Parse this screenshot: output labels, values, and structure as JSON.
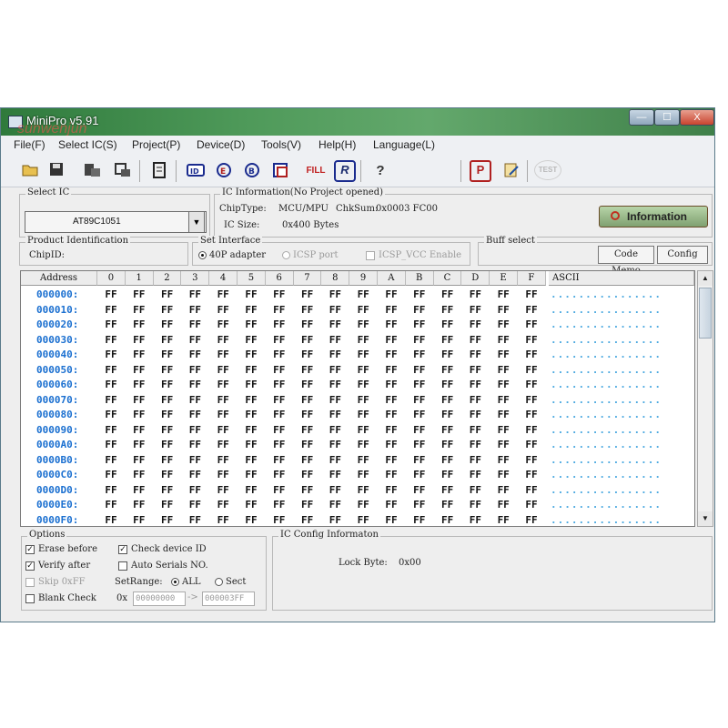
{
  "window": {
    "title": "MiniPro v5.91",
    "watermark": "sunwenjun",
    "controls": {
      "minimize": "—",
      "maximize": "☐",
      "close": "X"
    }
  },
  "menu": [
    "File(F)",
    "Select IC(S)",
    "Project(P)",
    "Device(D)",
    "Tools(V)",
    "Help(H)",
    "Language(L)"
  ],
  "toolbar": {
    "icons": [
      "open-icon",
      "save-icon",
      "load-icon",
      "save-file-icon",
      "chip-icon",
      "read-icon",
      "erase-icon",
      "blank-check-icon",
      "verify-icon",
      "fill-icon",
      "program-icon",
      "help-icon",
      "protect-icon",
      "edit-icon",
      "test-icon"
    ],
    "fill_label": "FILL",
    "r_label": "R",
    "p_label": "P",
    "test_label": "TEST",
    "help_label": "?"
  },
  "select_ic": {
    "label": "Select IC",
    "value": "AT89C1051",
    "arrow": "▼"
  },
  "ic_info": {
    "label": "IC Information(No Project opened)",
    "chip_type_label": "ChipType:",
    "chip_type": "MCU/MPU",
    "checksum_label": "ChkSum:",
    "checksum": "0x0003 FC00",
    "size_label": "IC Size:",
    "size": "0x400 Bytes",
    "info_button": "Information"
  },
  "product_id": {
    "label": "Product Identification",
    "chipid_label": "ChipID:"
  },
  "interface": {
    "label": "Set Interface",
    "option_40p": "40P adapter",
    "option_icsp": "ICSP port",
    "icsp_vcc": "ICSP_VCC Enable"
  },
  "buff_select": {
    "label": "Buff select",
    "code_memo": "Code Memo",
    "config": "Config"
  },
  "hex": {
    "address_header": "Address",
    "columns": [
      "0",
      "1",
      "2",
      "3",
      "4",
      "5",
      "6",
      "7",
      "8",
      "9",
      "A",
      "B",
      "C",
      "D",
      "E",
      "F"
    ],
    "ascii_header": "ASCII",
    "addresses": [
      "000000:",
      "000010:",
      "000020:",
      "000030:",
      "000040:",
      "000050:",
      "000060:",
      "000070:",
      "000080:",
      "000090:",
      "0000A0:",
      "0000B0:",
      "0000C0:",
      "0000D0:",
      "0000E0:",
      "0000F0:"
    ],
    "byte_value": "FF",
    "ascii_row": "................"
  },
  "options": {
    "label": "Options",
    "erase_before": "Erase before",
    "check_device_id": "Check device ID",
    "verify_after": "Verify after",
    "auto_serials": "Auto Serials NO.",
    "skip_0xff": "Skip 0xFF",
    "setrange_label": "SetRange:",
    "range_all": "ALL",
    "range_sect": "Sect",
    "blank_check": "Blank Check",
    "from_prefix": "0x",
    "from_value": "00000000",
    "arrow": "->",
    "to_value": "000003FF"
  },
  "config_info": {
    "label": "IC Config Informaton",
    "lock_byte_label": "Lock Byte:",
    "lock_byte_value": "0x00"
  }
}
